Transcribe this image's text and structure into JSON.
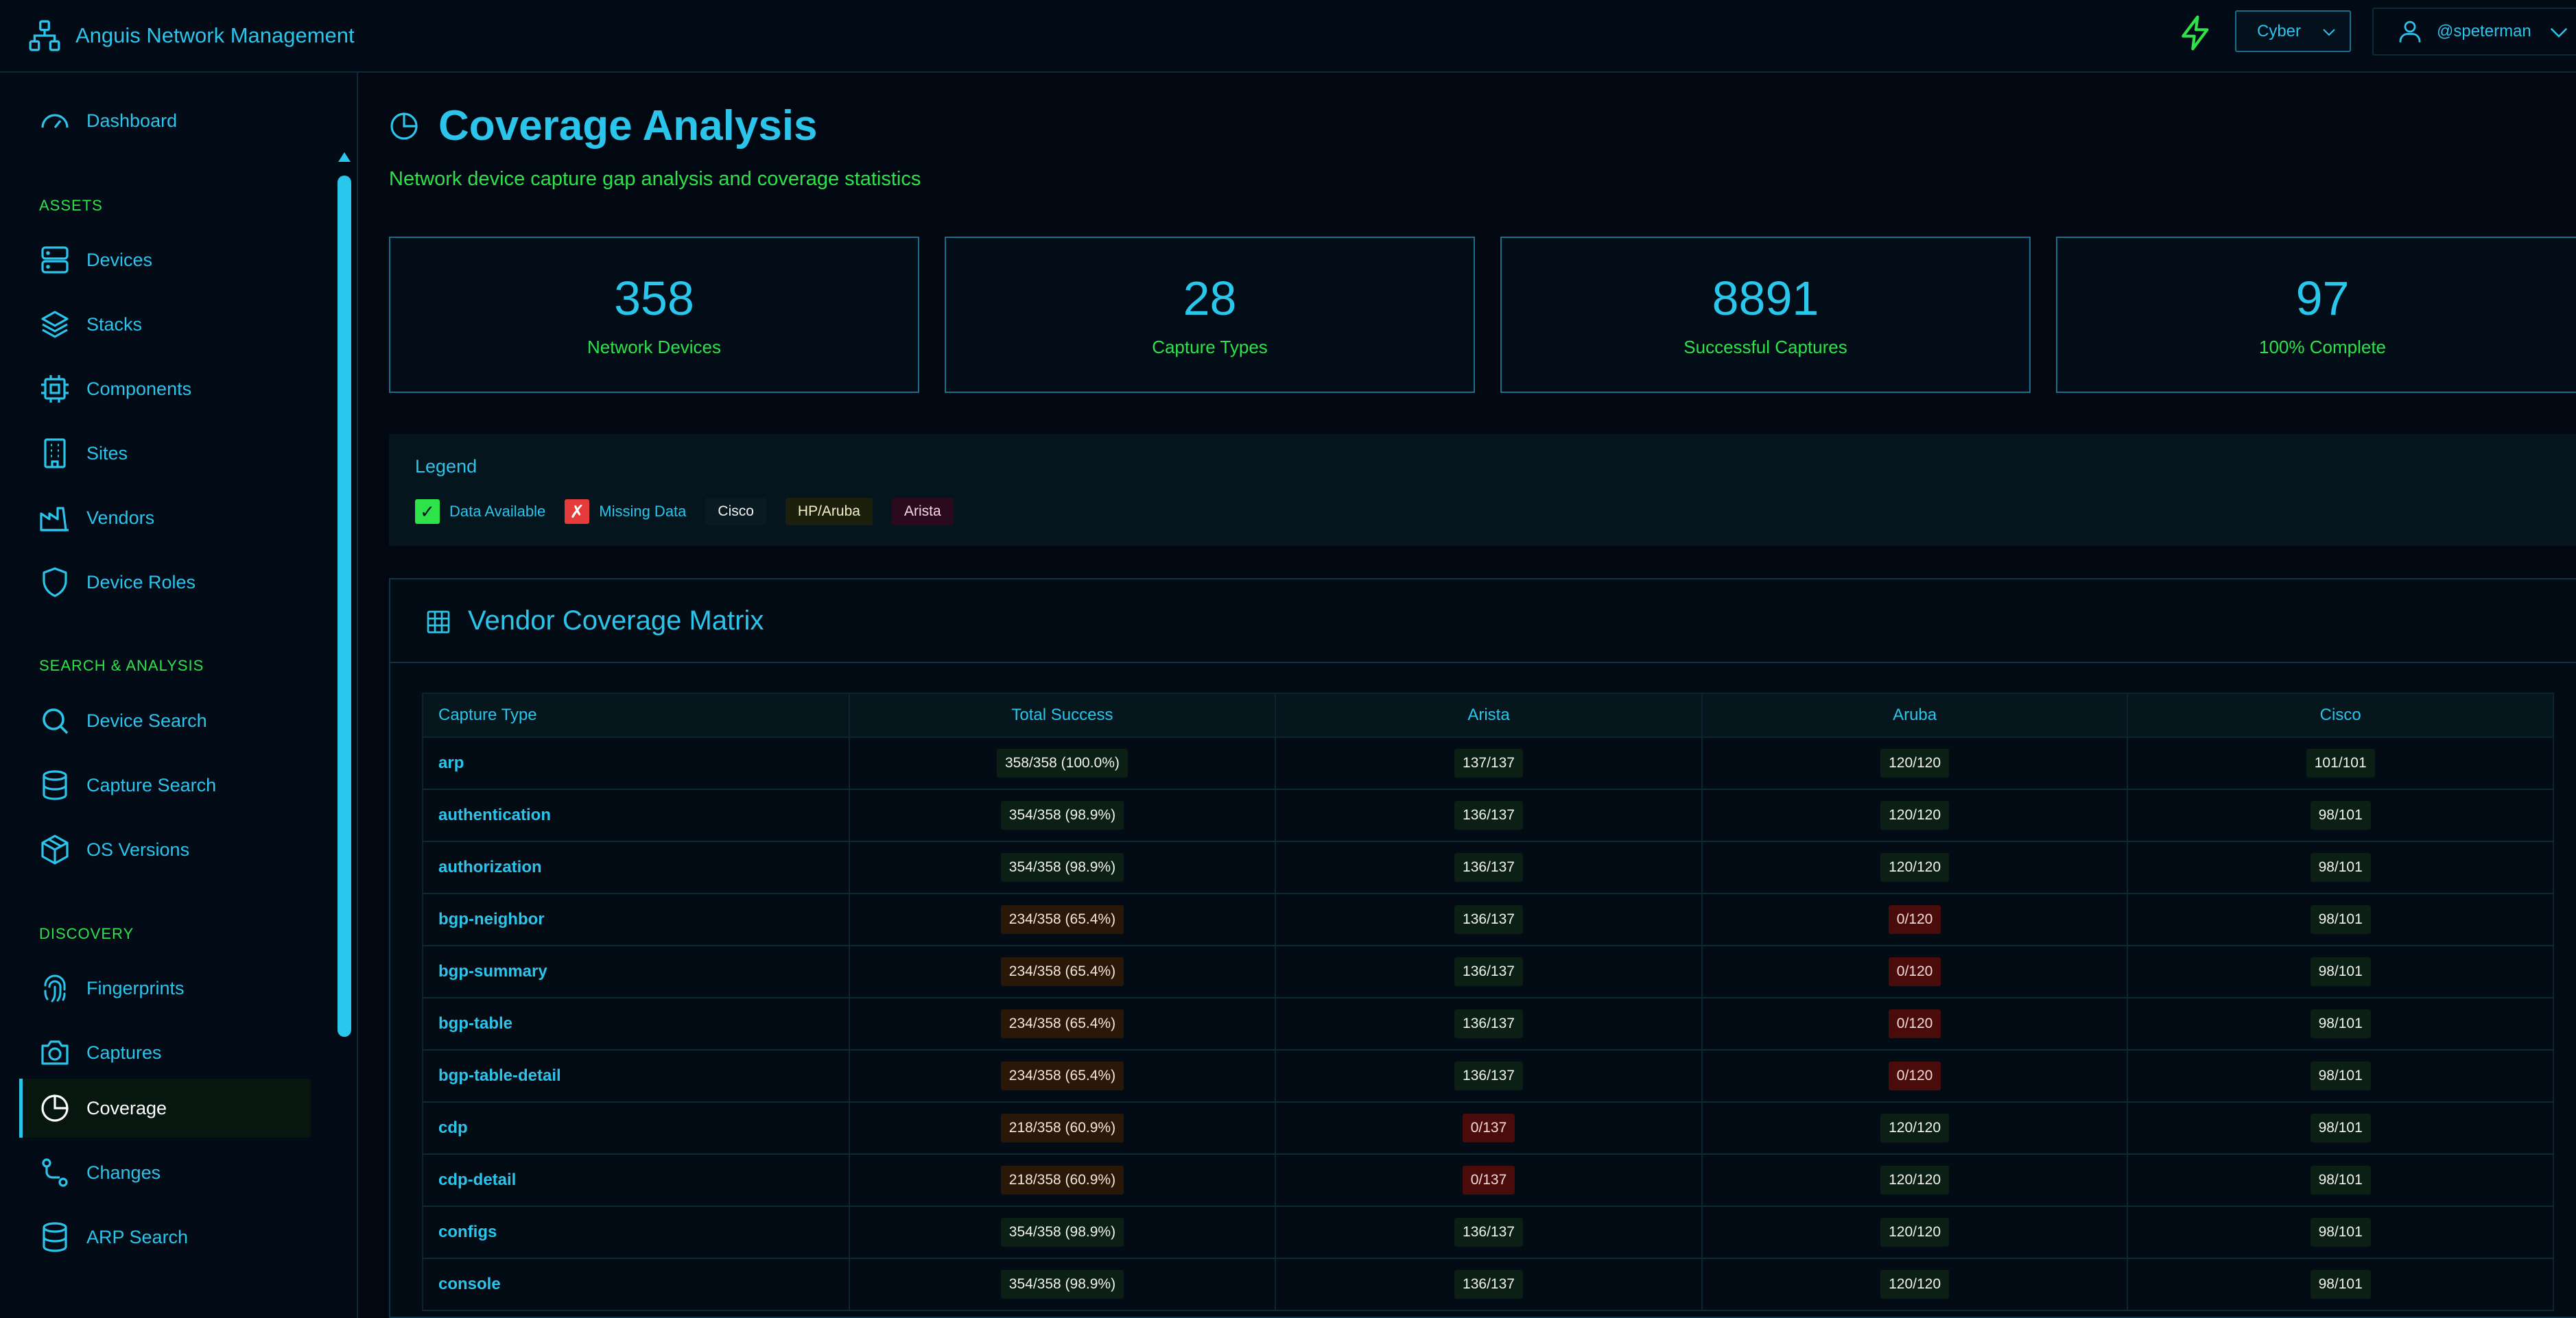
{
  "app": {
    "title": "Anguis Network Management"
  },
  "header": {
    "theme": "Cyber",
    "user": "@speterman"
  },
  "sidebar": {
    "dashboard": "Dashboard",
    "sections": {
      "assets": "ASSETS",
      "search": "SEARCH & ANALYSIS",
      "discovery": "DISCOVERY"
    },
    "items": {
      "devices": "Devices",
      "stacks": "Stacks",
      "components": "Components",
      "sites": "Sites",
      "vendors": "Vendors",
      "device_roles": "Device Roles",
      "device_search": "Device Search",
      "capture_search": "Capture Search",
      "os_versions": "OS Versions",
      "fingerprints": "Fingerprints",
      "captures": "Captures",
      "coverage": "Coverage",
      "changes": "Changes",
      "arp_search": "ARP Search"
    }
  },
  "page": {
    "title": "Coverage Analysis",
    "subtitle": "Network device capture gap analysis and coverage statistics"
  },
  "stats": [
    {
      "value": "358",
      "label": "Network Devices"
    },
    {
      "value": "28",
      "label": "Capture Types"
    },
    {
      "value": "8891",
      "label": "Successful Captures"
    },
    {
      "value": "97",
      "label": "100% Complete"
    }
  ],
  "legend": {
    "title": "Legend",
    "available": "Data Available",
    "missing": "Missing Data",
    "check_glyph": "✓",
    "x_glyph": "✗",
    "vendors": [
      {
        "name": "Cisco",
        "bg": "#0a1a22",
        "color": "#f2f2f2"
      },
      {
        "name": "HP/Aruba",
        "bg": "#1c1f0c",
        "color": "#f2f0c8"
      },
      {
        "name": "Arista",
        "bg": "#2a0a1c",
        "color": "#f5d6e6"
      }
    ]
  },
  "matrix": {
    "title": "Vendor Coverage Matrix",
    "columns": [
      "Capture Type",
      "Total Success",
      "Arista",
      "Aruba",
      "Cisco"
    ],
    "rows": [
      {
        "type": "arp",
        "total": "358/358 (100.0%)",
        "total_s": "ok",
        "arista": "137/137",
        "arista_s": "ok",
        "aruba": "120/120",
        "aruba_s": "ok",
        "cisco": "101/101",
        "cisco_s": "ok"
      },
      {
        "type": "authentication",
        "total": "354/358 (98.9%)",
        "total_s": "ok",
        "arista": "136/137",
        "arista_s": "ok",
        "aruba": "120/120",
        "aruba_s": "ok",
        "cisco": "98/101",
        "cisco_s": "ok"
      },
      {
        "type": "authorization",
        "total": "354/358 (98.9%)",
        "total_s": "ok",
        "arista": "136/137",
        "arista_s": "ok",
        "aruba": "120/120",
        "aruba_s": "ok",
        "cisco": "98/101",
        "cisco_s": "ok"
      },
      {
        "type": "bgp-neighbor",
        "total": "234/358 (65.4%)",
        "total_s": "warn",
        "arista": "136/137",
        "arista_s": "ok",
        "aruba": "0/120",
        "aruba_s": "bad",
        "cisco": "98/101",
        "cisco_s": "ok"
      },
      {
        "type": "bgp-summary",
        "total": "234/358 (65.4%)",
        "total_s": "warn",
        "arista": "136/137",
        "arista_s": "ok",
        "aruba": "0/120",
        "aruba_s": "bad",
        "cisco": "98/101",
        "cisco_s": "ok"
      },
      {
        "type": "bgp-table",
        "total": "234/358 (65.4%)",
        "total_s": "warn",
        "arista": "136/137",
        "arista_s": "ok",
        "aruba": "0/120",
        "aruba_s": "bad",
        "cisco": "98/101",
        "cisco_s": "ok"
      },
      {
        "type": "bgp-table-detail",
        "total": "234/358 (65.4%)",
        "total_s": "warn",
        "arista": "136/137",
        "arista_s": "ok",
        "aruba": "0/120",
        "aruba_s": "bad",
        "cisco": "98/101",
        "cisco_s": "ok"
      },
      {
        "type": "cdp",
        "total": "218/358 (60.9%)",
        "total_s": "warn",
        "arista": "0/137",
        "arista_s": "bad",
        "aruba": "120/120",
        "aruba_s": "ok",
        "cisco": "98/101",
        "cisco_s": "ok"
      },
      {
        "type": "cdp-detail",
        "total": "218/358 (60.9%)",
        "total_s": "warn",
        "arista": "0/137",
        "arista_s": "bad",
        "aruba": "120/120",
        "aruba_s": "ok",
        "cisco": "98/101",
        "cisco_s": "ok"
      },
      {
        "type": "configs",
        "total": "354/358 (98.9%)",
        "total_s": "ok",
        "arista": "136/137",
        "arista_s": "ok",
        "aruba": "120/120",
        "aruba_s": "ok",
        "cisco": "98/101",
        "cisco_s": "ok"
      },
      {
        "type": "console",
        "total": "354/358 (98.9%)",
        "total_s": "ok",
        "arista": "136/137",
        "arista_s": "ok",
        "aruba": "120/120",
        "aruba_s": "ok",
        "cisco": "98/101",
        "cisco_s": "ok"
      }
    ]
  },
  "colors": {
    "accent": "#2bc4ea",
    "green": "#2ee24a",
    "bg": "#020812"
  }
}
